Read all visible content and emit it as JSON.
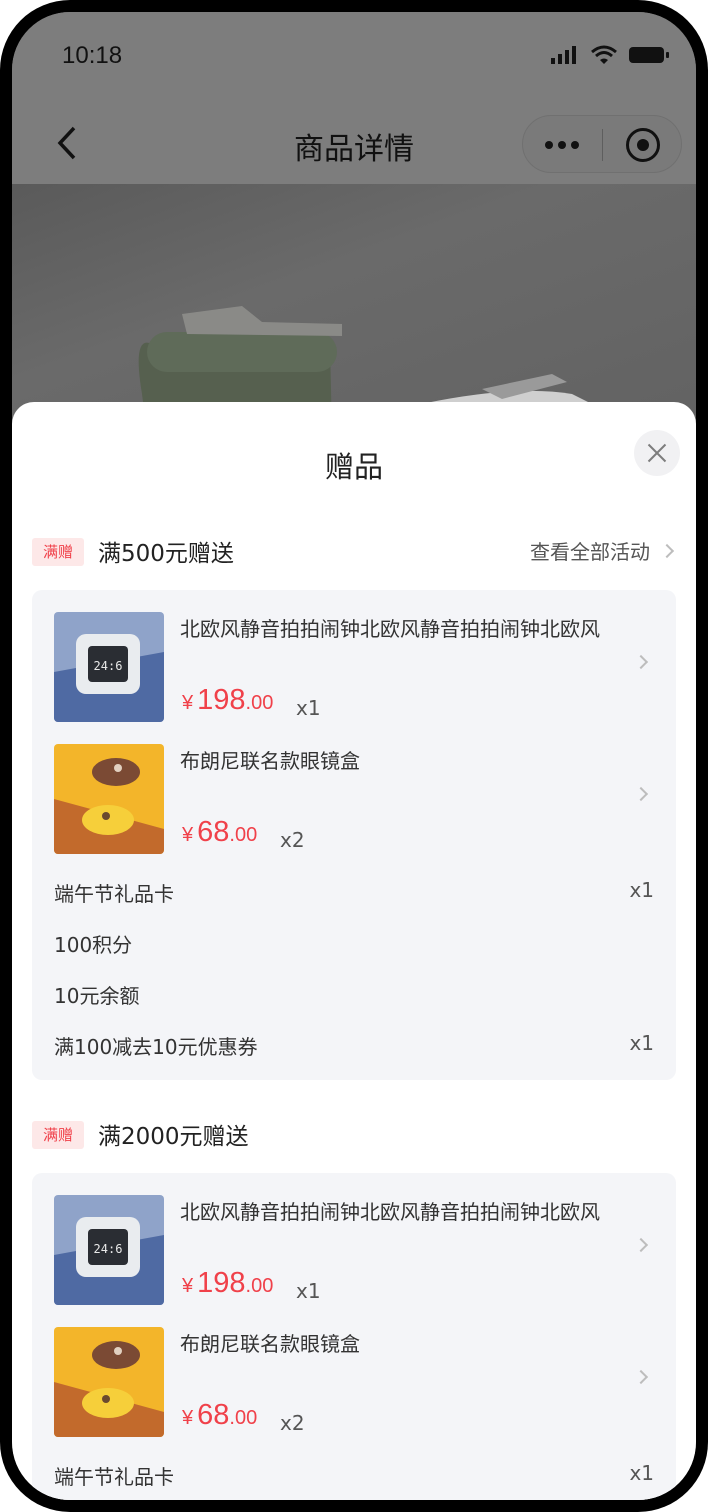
{
  "status": {
    "time": "10:18"
  },
  "nav": {
    "title": "商品详情"
  },
  "sheet": {
    "title": "赠品"
  },
  "sections": [
    {
      "tag": "满赠",
      "title": "满500元赠送",
      "view_all": "查看全部活动",
      "products": [
        {
          "name": "北欧风静音拍拍闹钟北欧风静音拍拍闹钟北欧风",
          "currency": "¥",
          "price_int": "198",
          "price_dec": ".00",
          "qty": "x1",
          "image": "clock"
        },
        {
          "name": "布朗尼联名款眼镜盒",
          "currency": "¥",
          "price_int": "68",
          "price_dec": ".00",
          "qty": "x2",
          "image": "glasses-case"
        }
      ],
      "items": [
        {
          "label": "端午节礼品卡",
          "qty": "x1"
        },
        {
          "label": "100积分",
          "qty": ""
        },
        {
          "label": "10元余额",
          "qty": ""
        },
        {
          "label": "满100减去10元优惠券",
          "qty": "x1"
        }
      ]
    },
    {
      "tag": "满赠",
      "title": "满2000元赠送",
      "products": [
        {
          "name": "北欧风静音拍拍闹钟北欧风静音拍拍闹钟北欧风",
          "currency": "¥",
          "price_int": "198",
          "price_dec": ".00",
          "qty": "x1",
          "image": "clock"
        },
        {
          "name": "布朗尼联名款眼镜盒",
          "currency": "¥",
          "price_int": "68",
          "price_dec": ".00",
          "qty": "x2",
          "image": "glasses-case"
        }
      ],
      "items": [
        {
          "label": "端午节礼品卡",
          "qty": "x1"
        }
      ]
    }
  ],
  "colors": {
    "accent": "#f0414a",
    "tag_bg": "#fde8e8",
    "card_bg": "#f4f5f8"
  }
}
